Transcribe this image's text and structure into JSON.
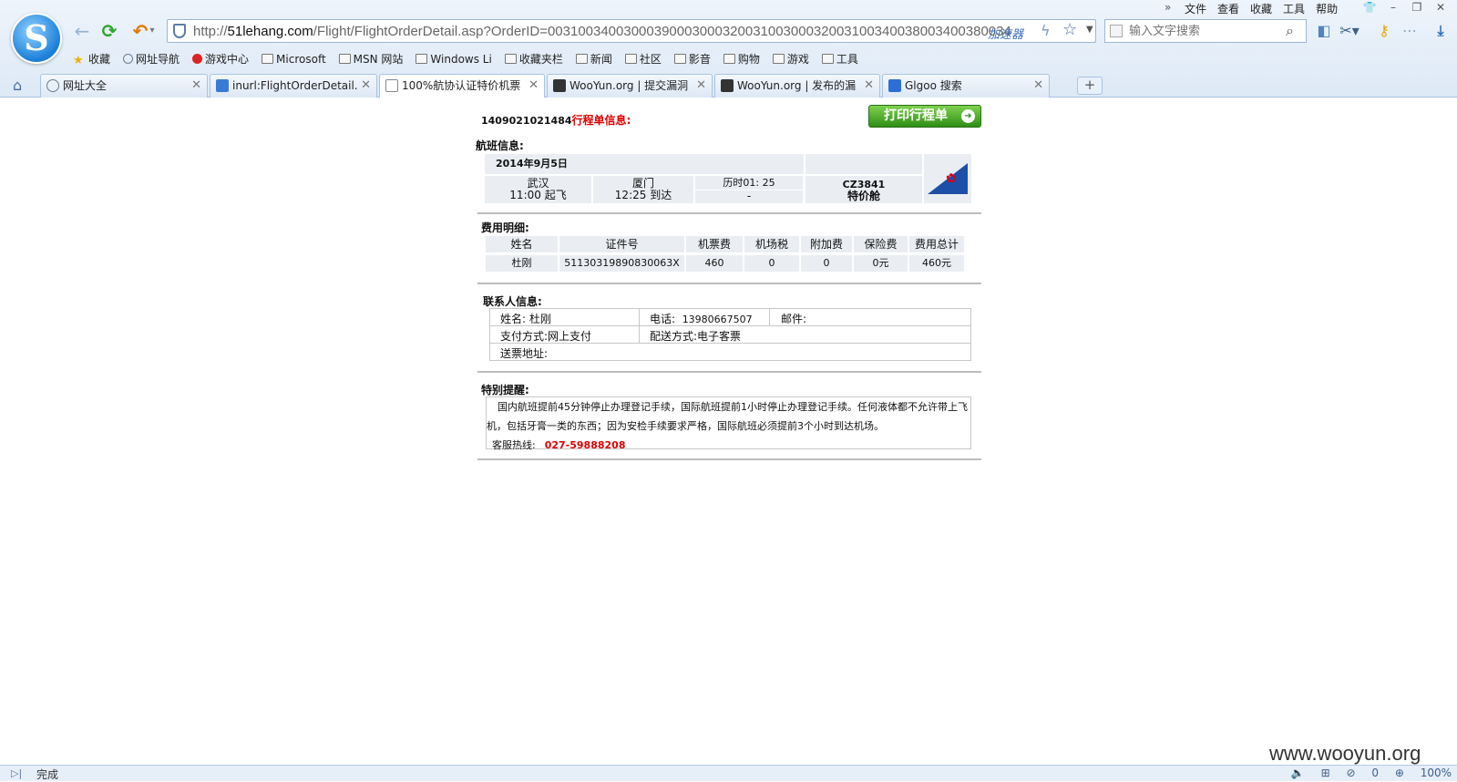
{
  "browser": {
    "url_prefix": "http://",
    "url_host": "51lehang.com",
    "url_path": "/Flight/FlightOrderDetail.asp?OrderID=0031003400300039000300032003100300032003100340038003400380034",
    "accelerator": "加速器",
    "search_placeholder": "输入文字搜索",
    "menu": [
      "文件",
      "查看",
      "收藏",
      "工具",
      "帮助"
    ],
    "bookmarks": [
      {
        "label": "收藏",
        "icon": "star-icon"
      },
      {
        "label": "网址导航",
        "icon": "globe-icon"
      },
      {
        "label": "游戏中心",
        "icon": "game-icon"
      },
      {
        "label": "Microsoft",
        "icon": "folder-icon"
      },
      {
        "label": "MSN 网站",
        "icon": "folder-icon"
      },
      {
        "label": "Windows Li",
        "icon": "folder-icon"
      },
      {
        "label": "收藏夹栏",
        "icon": "folder-icon"
      },
      {
        "label": "新闻",
        "icon": "folder-icon"
      },
      {
        "label": "社区",
        "icon": "folder-icon"
      },
      {
        "label": "影音",
        "icon": "folder-icon"
      },
      {
        "label": "购物",
        "icon": "folder-icon"
      },
      {
        "label": "游戏",
        "icon": "folder-icon"
      },
      {
        "label": "工具",
        "icon": "folder-icon"
      }
    ],
    "tabs": [
      {
        "label": "网址大全",
        "icon": "globe-icon"
      },
      {
        "label": "inurl:FlightOrderDetail.",
        "icon": "search-icon"
      },
      {
        "label": "100%航协认证特价机票",
        "icon": "page-icon",
        "active": true
      },
      {
        "label": "WooYun.org | 提交漏洞",
        "icon": "wooyun-icon"
      },
      {
        "label": "WooYun.org | 发布的漏",
        "icon": "wooyun-icon"
      },
      {
        "label": "Glgoo 搜索",
        "icon": "glgoo-icon"
      }
    ],
    "status_text": "完成",
    "status_items": [
      "0",
      "100%"
    ]
  },
  "order": {
    "number": "1409021021484",
    "title": "行程单信息:",
    "print_label": "打印行程单"
  },
  "flight": {
    "section_title": "航班信息:",
    "date": "2014年9月5日",
    "from_city": "武汉",
    "from_time": "11:00 起飞",
    "to_city": "厦门",
    "to_time": "12:25 到达",
    "duration": "历时01: 25",
    "duration_extra": "-",
    "flight_no": "CZ3841",
    "cabin": "特价舱"
  },
  "fees": {
    "section_title": "费用明细:",
    "headers": [
      "姓名",
      "证件号",
      "机票费",
      "机场税",
      "附加费",
      "保险费",
      "费用总计"
    ],
    "row": [
      "杜刚",
      "51130319890830063X",
      "460",
      "0",
      "0",
      "0元",
      "460元"
    ]
  },
  "contact": {
    "section_title": "联系人信息:",
    "name_label": "姓名:",
    "name": "杜刚",
    "phone_label": "电话:",
    "phone": "13980667507",
    "email_label": "邮件:",
    "payment_label": "支付方式:",
    "payment": "网上支付",
    "delivery_label": "配送方式:",
    "delivery": "电子客票",
    "address_label": "送票地址:"
  },
  "notice": {
    "section_title": "特别提醒:",
    "text": "国内航班提前45分钟停止办理登记手续，国际航班提前1小时停止办理登记手续。任何液体都不允许带上飞机，包括牙膏一类的东西；因为安检手续要求严格，国际航班必须提前3个小时到达机场。",
    "hotline_label": "客服热线:",
    "hotline": "027-59888208"
  },
  "watermark": "www.wooyun.org"
}
